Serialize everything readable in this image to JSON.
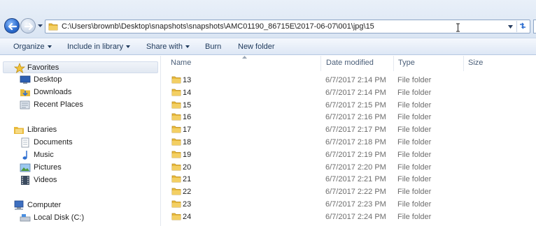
{
  "address_bar": {
    "path": "C:\\Users\\brownb\\Desktop\\snapshots\\snapshots\\AMC01190_86715E\\2017-06-07\\001\\jpg\\15"
  },
  "toolbar": {
    "organize": "Organize",
    "include_in_library": "Include in library",
    "share_with": "Share with",
    "burn": "Burn",
    "new_folder": "New folder"
  },
  "nav": {
    "favorites": "Favorites",
    "desktop": "Desktop",
    "downloads": "Downloads",
    "recent_places": "Recent Places",
    "libraries": "Libraries",
    "documents": "Documents",
    "music": "Music",
    "pictures": "Pictures",
    "videos": "Videos",
    "computer": "Computer",
    "local_disk": "Local Disk (C:)"
  },
  "columns": {
    "name": "Name",
    "date_modified": "Date modified",
    "type": "Type",
    "size": "Size"
  },
  "files": [
    {
      "name": "13",
      "date": "6/7/2017 2:14 PM",
      "type": "File folder"
    },
    {
      "name": "14",
      "date": "6/7/2017 2:14 PM",
      "type": "File folder"
    },
    {
      "name": "15",
      "date": "6/7/2017 2:15 PM",
      "type": "File folder"
    },
    {
      "name": "16",
      "date": "6/7/2017 2:16 PM",
      "type": "File folder"
    },
    {
      "name": "17",
      "date": "6/7/2017 2:17 PM",
      "type": "File folder"
    },
    {
      "name": "18",
      "date": "6/7/2017 2:18 PM",
      "type": "File folder"
    },
    {
      "name": "19",
      "date": "6/7/2017 2:19 PM",
      "type": "File folder"
    },
    {
      "name": "20",
      "date": "6/7/2017 2:20 PM",
      "type": "File folder"
    },
    {
      "name": "21",
      "date": "6/7/2017 2:21 PM",
      "type": "File folder"
    },
    {
      "name": "22",
      "date": "6/7/2017 2:22 PM",
      "type": "File folder"
    },
    {
      "name": "23",
      "date": "6/7/2017 2:23 PM",
      "type": "File folder"
    },
    {
      "name": "24",
      "date": "6/7/2017 2:24 PM",
      "type": "File folder"
    }
  ],
  "colors": {
    "folder": "#e8b93a",
    "accent": "#2f6fd0"
  }
}
